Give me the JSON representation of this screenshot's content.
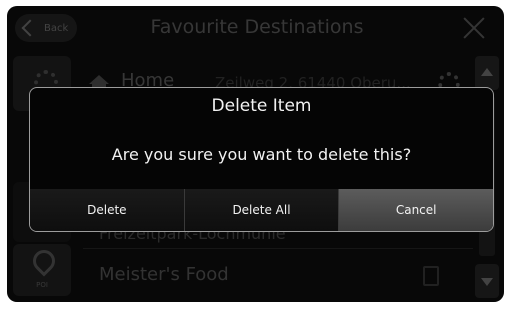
{
  "header": {
    "back_label": "Back",
    "title": "Favourite Destinations"
  },
  "sidebar": {
    "poi_label": "POI"
  },
  "list": {
    "items": [
      {
        "name": "Home",
        "address": "Zeilweg 2, 61440 Oberu..."
      },
      {
        "name": "Freizeitpark-Lochmühle"
      },
      {
        "name": "Meister's Food"
      }
    ]
  },
  "dialog": {
    "title": "Delete Item",
    "message": "Are you sure you want to delete this?",
    "buttons": {
      "delete": "Delete",
      "delete_all": "Delete All",
      "cancel": "Cancel"
    }
  }
}
